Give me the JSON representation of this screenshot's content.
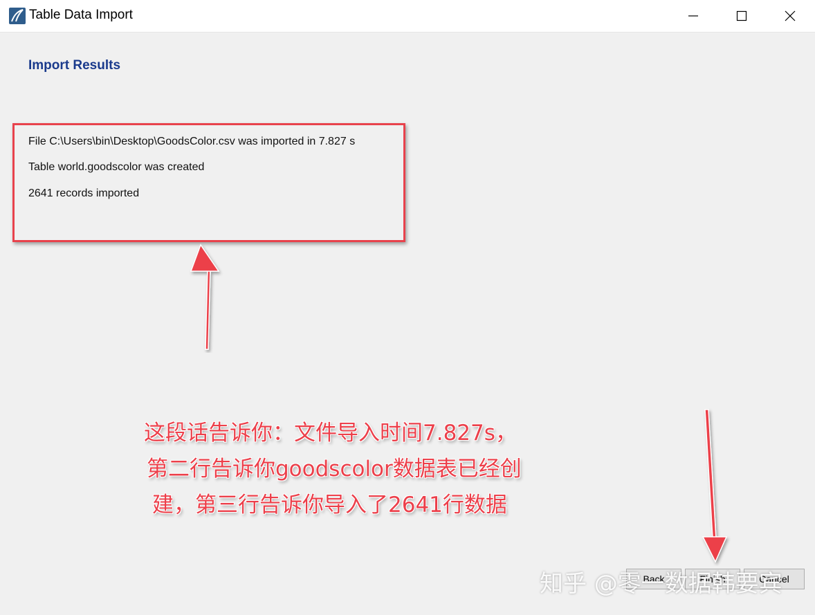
{
  "window": {
    "title": "Table Data Import",
    "app_icon": "mysql-workbench-icon",
    "controls": [
      "minimize-icon",
      "maximize-icon",
      "close-icon"
    ]
  },
  "page": {
    "heading": "Import Results",
    "results": [
      "File C:\\Users\\bin\\Desktop\\GoodsColor.csv was imported in 7.827 s",
      "Table world.goodscolor was created",
      "2641 records imported"
    ]
  },
  "annotation": {
    "color": "#ec3f4a",
    "lines": [
      "这段话告诉你：文件导入时间7.827s，",
      "第二行告诉你goodscolor数据表已经创",
      "建，第三行告诉你导入了2641行数据"
    ]
  },
  "buttons": {
    "back": "Back",
    "finish": "Finish",
    "cancel": "Cancel"
  },
  "watermark": "知乎 @零一数据韩要宾"
}
